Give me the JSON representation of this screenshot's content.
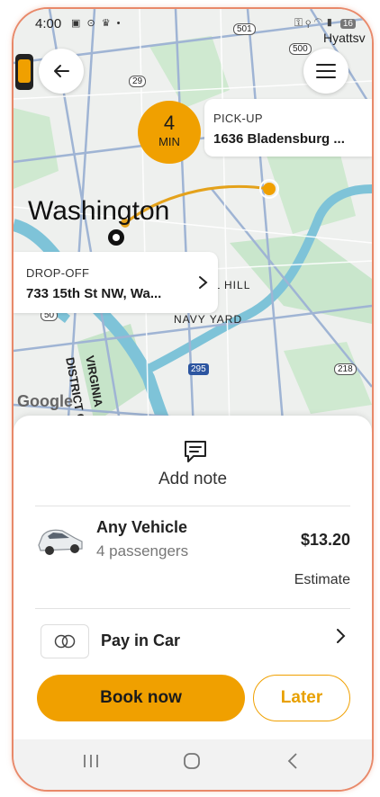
{
  "status_bar": {
    "time": "4:00",
    "left_icons": "▣ ⊙ ♛ •",
    "right_icons": "⚿ ⚲ ◠ ▮",
    "battery": "16"
  },
  "map": {
    "city_label": "Washington",
    "labels": {
      "capitol_hill": "CAPITOL HILL",
      "navy_yard": "NAVY YARD",
      "district_of_columbia": "DISTRICT OF CO",
      "virginia": "VIRGINIA",
      "hyattsville": "Hyattsv",
      "google": "Google"
    },
    "shields": {
      "r501": "501",
      "r500": "500",
      "r29": "29",
      "r295": "295",
      "r218": "218",
      "r50": "50"
    }
  },
  "pickup": {
    "eta_number": "4",
    "eta_unit": "MIN",
    "label": "PICK-UP",
    "address": "1636 Bladensburg ..."
  },
  "dropoff": {
    "label": "DROP-OFF",
    "address": "733 15th St NW, Wa..."
  },
  "note": {
    "label": "Add note"
  },
  "vehicle": {
    "name": "Any Vehicle",
    "passengers": "4 passengers",
    "price": "$13.20",
    "price_note": "Estimate"
  },
  "payment": {
    "label": "Pay in Car"
  },
  "actions": {
    "book_label": "Book now",
    "later_label": "Later"
  },
  "colors": {
    "accent": "#f0a000",
    "frame": "#e8896a",
    "water": "#7ec3d8",
    "park": "#bfe3c3",
    "route": "#e4a21b"
  }
}
